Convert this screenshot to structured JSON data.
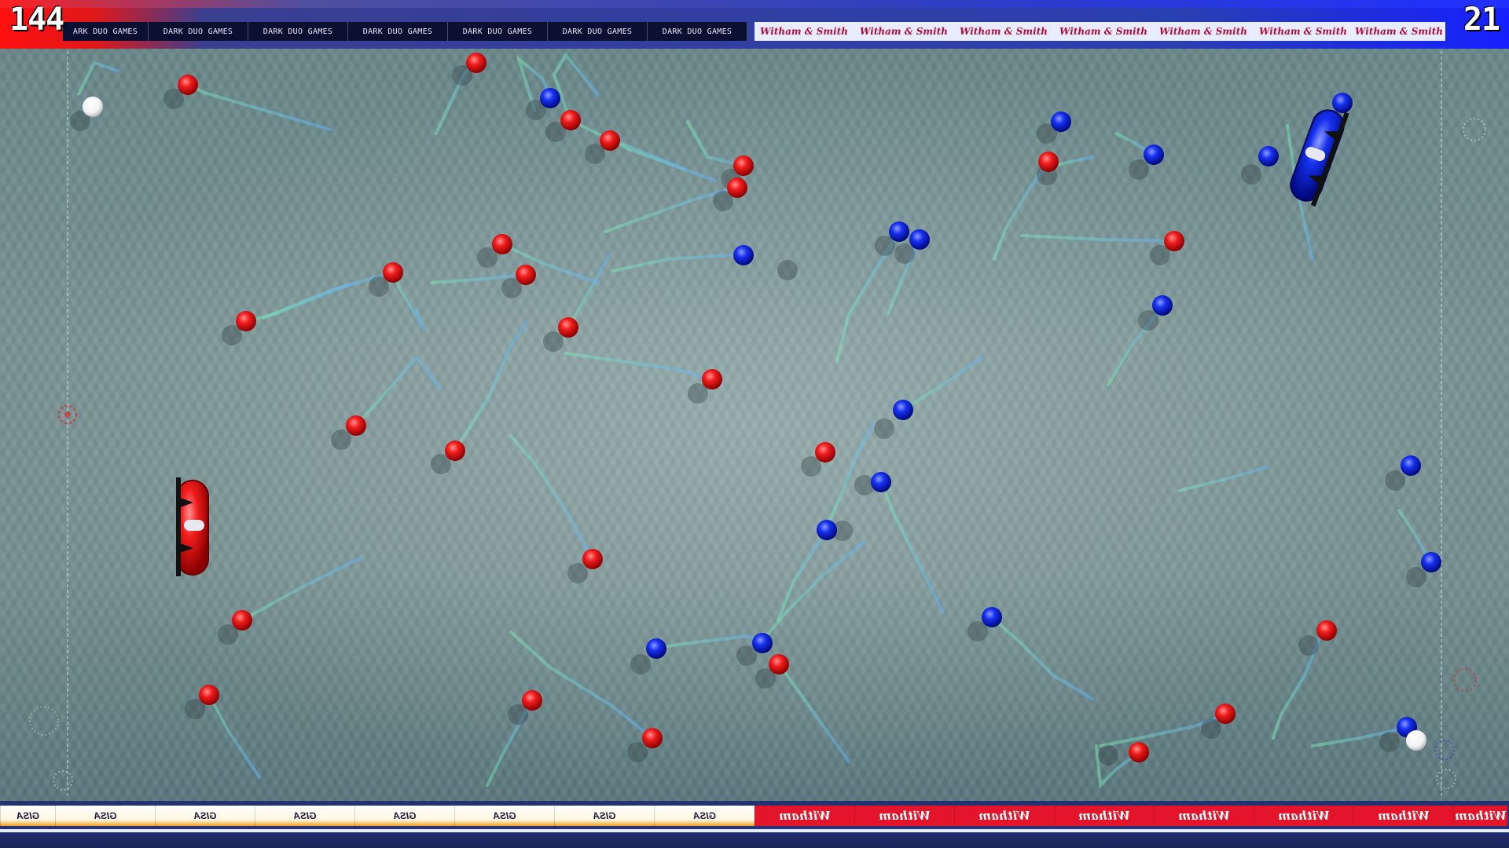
{
  "score": {
    "red": "144",
    "blue": "21"
  },
  "ads": {
    "top_dark_text": "DARK DUO GAMES",
    "top_dark_first_text": "ARK DUO GAMES",
    "top_witham_text": "Witham & Smith",
    "bottom_gisa_text": "GISA",
    "bottom_witham_text": "Witham"
  },
  "colors": {
    "red_team": "#e81818",
    "blue_team": "#1a2ae8",
    "ball": "#ffffff"
  }
}
